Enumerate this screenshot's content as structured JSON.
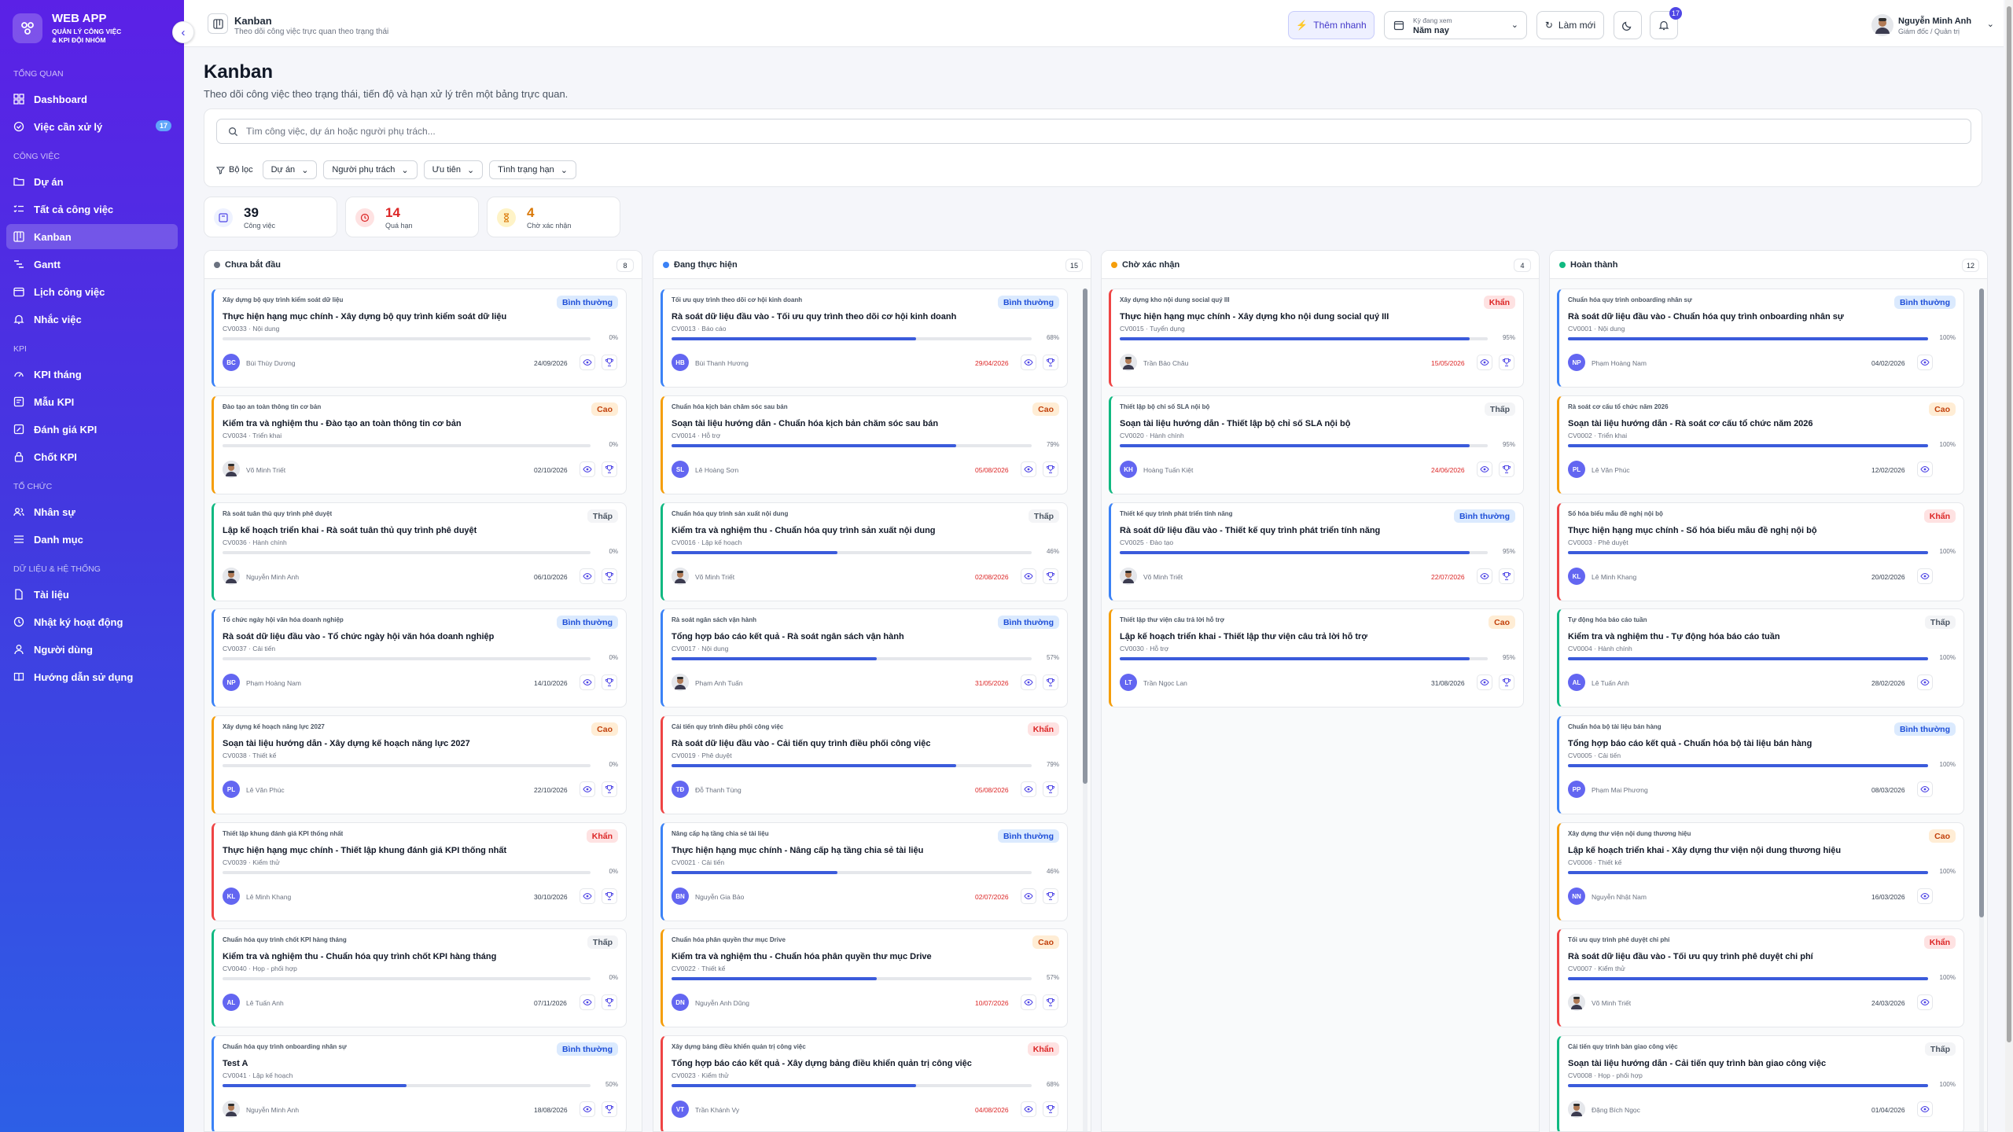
{
  "brand": {
    "name": "WEB APP",
    "sub1": "QUẢN LÝ CÔNG VIỆC",
    "sub2": "& KPI ĐỘI NHÓM"
  },
  "sidebar": {
    "sections": [
      {
        "title": "TỔNG QUAN",
        "items": [
          {
            "label": "Dashboard",
            "icon": "dashboard-icon"
          },
          {
            "label": "Việc cần xử lý",
            "icon": "check-circle-icon",
            "badge": "17"
          }
        ]
      },
      {
        "title": "CÔNG VIỆC",
        "items": [
          {
            "label": "Dự án",
            "icon": "folder-icon"
          },
          {
            "label": "Tất cả công việc",
            "icon": "list-check-icon"
          },
          {
            "label": "Kanban",
            "icon": "kanban-icon",
            "active": true
          },
          {
            "label": "Gantt",
            "icon": "gantt-icon"
          },
          {
            "label": "Lịch công việc",
            "icon": "calendar-icon"
          },
          {
            "label": "Nhắc việc",
            "icon": "bell-icon"
          }
        ]
      },
      {
        "title": "KPI",
        "items": [
          {
            "label": "KPI tháng",
            "icon": "gauge-icon"
          },
          {
            "label": "Mẫu KPI",
            "icon": "template-icon"
          },
          {
            "label": "Đánh giá KPI",
            "icon": "edit-icon"
          },
          {
            "label": "Chốt KPI",
            "icon": "lock-icon"
          }
        ]
      },
      {
        "title": "TỔ CHỨC",
        "items": [
          {
            "label": "Nhân sự",
            "icon": "users-icon"
          },
          {
            "label": "Danh mục",
            "icon": "category-icon"
          }
        ]
      },
      {
        "title": "DỮ LIỆU & HỆ THỐNG",
        "items": [
          {
            "label": "Tài liệu",
            "icon": "document-icon"
          },
          {
            "label": "Nhật ký hoạt động",
            "icon": "history-icon"
          },
          {
            "label": "Người dùng",
            "icon": "user-icon"
          },
          {
            "label": "Hướng dẫn sử dụng",
            "icon": "book-icon"
          }
        ]
      }
    ]
  },
  "topbar": {
    "title": "Kanban",
    "subtitle": "Theo dõi công việc trực quan theo trạng thái",
    "quick_add": "Thêm nhanh",
    "period_label": "Kỳ đang xem",
    "period_value": "Năm nay",
    "refresh": "Làm mới",
    "notif_count": "17",
    "user_name": "Nguyễn Minh Anh",
    "user_role": "Giám đốc / Quản trị"
  },
  "page": {
    "title": "Kanban",
    "subtitle": "Theo dõi công việc theo trạng thái, tiến độ và hạn xử lý trên một bảng trực quan."
  },
  "search": {
    "placeholder": "Tìm công việc, dự án hoặc người phụ trách..."
  },
  "filters": {
    "label": "Bộ lọc",
    "chips": [
      "Dự án",
      "Người phụ trách",
      "Ưu tiên",
      "Tình trạng hạn"
    ]
  },
  "stats": [
    {
      "value": "39",
      "label": "Công việc",
      "color": "#111827",
      "icon": "board-icon"
    },
    {
      "value": "14",
      "label": "Quá hạn",
      "color": "#dc2626",
      "icon": "clock-icon"
    },
    {
      "value": "4",
      "label": "Chờ xác nhận",
      "color": "#d97706",
      "icon": "hourglass-icon"
    }
  ],
  "colors": {
    "accent": "#4f46e5",
    "priority": {
      "Bình thường": {
        "bg": "#dbeafe",
        "fg": "#1d4ed8",
        "border": "#3b82f6"
      },
      "Cao": {
        "bg": "#ffedd5",
        "fg": "#c2410c",
        "border": "#f59e0b"
      },
      "Khẩn": {
        "bg": "#fee2e2",
        "fg": "#dc2626",
        "border": "#ef4444"
      },
      "Thấp": {
        "bg": "#f3f4f6",
        "fg": "#4b5563",
        "border": "#10b981"
      }
    }
  },
  "columns": [
    {
      "title": "Chưa bắt đầu",
      "count": "8",
      "dot": "#6b7280",
      "thumb_top": 0,
      "thumb_h": 0,
      "cards": [
        {
          "parent": "Xây dựng bộ quy trình kiểm soát dữ liệu",
          "priority": "Bình thường",
          "title": "Thực hiện hạng mục chính - Xây dựng bộ quy trình kiểm soát dữ liệu",
          "code": "CV0033 · Nội dung",
          "progress": 0,
          "initials": "BC",
          "avatar": "#6366f1",
          "person": "Bùi Thùy Dương",
          "date": "24/09/2026",
          "overdue": false
        },
        {
          "parent": "Đào tạo an toàn thông tin cơ bản",
          "priority": "Cao",
          "title": "Kiểm tra và nghiệm thu - Đào tạo an toàn thông tin cơ bản",
          "code": "CV0034 · Triển khai",
          "progress": 0,
          "initials": "",
          "avatar": "photo",
          "person": "Võ Minh Triết",
          "date": "02/10/2026",
          "overdue": false
        },
        {
          "parent": "Rà soát tuân thủ quy trình phê duyệt",
          "priority": "Thấp",
          "title": "Lập kế hoạch triển khai - Rà soát tuân thủ quy trình phê duyệt",
          "code": "CV0036 · Hành chính",
          "progress": 0,
          "initials": "",
          "avatar": "photo",
          "person": "Nguyễn Minh Anh",
          "date": "06/10/2026",
          "overdue": false
        },
        {
          "parent": "Tổ chức ngày hội văn hóa doanh nghiệp",
          "priority": "Bình thường",
          "title": "Rà soát dữ liệu đầu vào - Tổ chức ngày hội văn hóa doanh nghiệp",
          "code": "CV0037 · Cải tiến",
          "progress": 0,
          "initials": "NP",
          "avatar": "#6366f1",
          "person": "Phạm Hoàng Nam",
          "date": "14/10/2026",
          "overdue": false
        },
        {
          "parent": "Xây dựng kế hoạch năng lực 2027",
          "priority": "Cao",
          "title": "Soạn tài liệu hướng dẫn - Xây dựng kế hoạch năng lực 2027",
          "code": "CV0038 · Thiết kế",
          "progress": 0,
          "initials": "PL",
          "avatar": "#6366f1",
          "person": "Lê Văn Phúc",
          "date": "22/10/2026",
          "overdue": false
        },
        {
          "parent": "Thiết lập khung đánh giá KPI thống nhất",
          "priority": "Khẩn",
          "title": "Thực hiện hạng mục chính - Thiết lập khung đánh giá KPI thống nhất",
          "code": "CV0039 · Kiểm thử",
          "progress": 0,
          "initials": "KL",
          "avatar": "#6366f1",
          "person": "Lê Minh Khang",
          "date": "30/10/2026",
          "overdue": false
        },
        {
          "parent": "Chuẩn hóa quy trình chốt KPI hàng tháng",
          "priority": "Thấp",
          "title": "Kiểm tra và nghiệm thu - Chuẩn hóa quy trình chốt KPI hàng tháng",
          "code": "CV0040 · Họp - phối hợp",
          "progress": 0,
          "initials": "AL",
          "avatar": "#6366f1",
          "person": "Lê Tuấn Anh",
          "date": "07/11/2026",
          "overdue": false
        },
        {
          "parent": "Chuẩn hóa quy trình onboarding nhân sự",
          "priority": "Bình thường",
          "title": "Test A",
          "code": "CV0041 · Lập kế hoạch",
          "progress": 50,
          "initials": "",
          "avatar": "photo",
          "person": "Nguyễn Minh Anh",
          "date": "18/08/2026",
          "overdue": false
        }
      ]
    },
    {
      "title": "Đang thực hiện",
      "count": "15",
      "dot": "#3b82f6",
      "thumb_top": 0,
      "thumb_h": 630,
      "cards": [
        {
          "parent": "Tối ưu quy trình theo dõi cơ hội kinh doanh",
          "priority": "Bình thường",
          "title": "Rà soát dữ liệu đầu vào - Tối ưu quy trình theo dõi cơ hội kinh doanh",
          "code": "CV0013 · Báo cáo",
          "progress": 68,
          "initials": "HB",
          "avatar": "#6366f1",
          "person": "Bùi Thanh Hương",
          "date": "29/04/2026",
          "overdue": true
        },
        {
          "parent": "Chuẩn hóa kịch bản chăm sóc sau bán",
          "priority": "Cao",
          "title": "Soạn tài liệu hướng dẫn - Chuẩn hóa kịch bản chăm sóc sau bán",
          "code": "CV0014 · Hỗ trợ",
          "progress": 79,
          "initials": "SL",
          "avatar": "#6366f1",
          "person": "Lê Hoàng Sơn",
          "date": "05/08/2026",
          "overdue": true
        },
        {
          "parent": "Chuẩn hóa quy trình sản xuất nội dung",
          "priority": "Thấp",
          "title": "Kiểm tra và nghiệm thu - Chuẩn hóa quy trình sản xuất nội dung",
          "code": "CV0016 · Lập kế hoạch",
          "progress": 46,
          "initials": "",
          "avatar": "photo",
          "person": "Võ Minh Triết",
          "date": "02/08/2026",
          "overdue": true
        },
        {
          "parent": "Rà soát ngân sách vận hành",
          "priority": "Bình thường",
          "title": "Tổng hợp báo cáo kết quả - Rà soát ngân sách vận hành",
          "code": "CV0017 · Nội dung",
          "progress": 57,
          "initials": "",
          "avatar": "photo",
          "person": "Phạm Anh Tuấn",
          "date": "31/05/2026",
          "overdue": true
        },
        {
          "parent": "Cải tiến quy trình điều phối công việc",
          "priority": "Khẩn",
          "title": "Rà soát dữ liệu đầu vào - Cải tiến quy trình điều phối công việc",
          "code": "CV0019 · Phê duyệt",
          "progress": 79,
          "initials": "TĐ",
          "avatar": "#6366f1",
          "person": "Đỗ Thanh Tùng",
          "date": "05/08/2026",
          "overdue": true
        },
        {
          "parent": "Nâng cấp hạ tầng chia sẻ tài liệu",
          "priority": "Bình thường",
          "title": "Thực hiện hạng mục chính - Nâng cấp hạ tầng chia sẻ tài liệu",
          "code": "CV0021 · Cải tiến",
          "progress": 46,
          "initials": "BN",
          "avatar": "#6366f1",
          "person": "Nguyễn Gia Bảo",
          "date": "02/07/2026",
          "overdue": true
        },
        {
          "parent": "Chuẩn hóa phân quyền thư mục Drive",
          "priority": "Cao",
          "title": "Kiểm tra và nghiệm thu - Chuẩn hóa phân quyền thư mục Drive",
          "code": "CV0022 · Thiết kế",
          "progress": 57,
          "initials": "DN",
          "avatar": "#6366f1",
          "person": "Nguyễn Anh Dũng",
          "date": "10/07/2026",
          "overdue": true
        },
        {
          "parent": "Xây dựng bảng điều khiển quản trị công việc",
          "priority": "Khẩn",
          "title": "Tổng hợp báo cáo kết quả - Xây dựng bảng điều khiển quản trị công việc",
          "code": "CV0023 · Kiểm thử",
          "progress": 68,
          "initials": "VT",
          "avatar": "#6366f1",
          "person": "Trần Khánh Vy",
          "date": "04/08/2026",
          "overdue": true
        }
      ]
    },
    {
      "title": "Chờ xác nhận",
      "count": "4",
      "dot": "#f59e0b",
      "thumb_top": 0,
      "thumb_h": 0,
      "cards": [
        {
          "parent": "Xây dựng kho nội dung social quý III",
          "priority": "Khẩn",
          "title": "Thực hiện hạng mục chính - Xây dựng kho nội dung social quý III",
          "code": "CV0015 · Tuyển dụng",
          "progress": 95,
          "initials": "",
          "avatar": "photo",
          "person": "Trần Bảo Châu",
          "date": "15/05/2026",
          "overdue": true
        },
        {
          "parent": "Thiết lập bộ chỉ số SLA nội bộ",
          "priority": "Thấp",
          "title": "Soạn tài liệu hướng dẫn - Thiết lập bộ chỉ số SLA nội bộ",
          "code": "CV0020 · Hành chính",
          "progress": 95,
          "initials": "KH",
          "avatar": "#6366f1",
          "person": "Hoàng Tuấn Kiệt",
          "date": "24/06/2026",
          "overdue": true
        },
        {
          "parent": "Thiết kế quy trình phát triển tính năng",
          "priority": "Bình thường",
          "title": "Rà soát dữ liệu đầu vào - Thiết kế quy trình phát triển tính năng",
          "code": "CV0025 · Đào tạo",
          "progress": 95,
          "initials": "",
          "avatar": "photo",
          "person": "Võ Minh Triết",
          "date": "22/07/2026",
          "overdue": true
        },
        {
          "parent": "Thiết lập thư viện câu trả lời hỗ trợ",
          "priority": "Cao",
          "title": "Lập kế hoạch triển khai - Thiết lập thư viện câu trả lời hỗ trợ",
          "code": "CV0030 · Hỗ trợ",
          "progress": 95,
          "initials": "LT",
          "avatar": "#6366f1",
          "person": "Trần Ngọc Lan",
          "date": "31/08/2026",
          "overdue": false
        }
      ]
    },
    {
      "title": "Hoàn thành",
      "count": "12",
      "dot": "#10b981",
      "thumb_top": 0,
      "thumb_h": 800,
      "cards": [
        {
          "parent": "Chuẩn hóa quy trình onboarding nhân sự",
          "priority": "Bình thường",
          "title": "Rà soát dữ liệu đầu vào - Chuẩn hóa quy trình onboarding nhân sự",
          "code": "CV0001 · Nội dung",
          "progress": 100,
          "initials": "NP",
          "avatar": "#6366f1",
          "person": "Phạm Hoàng Nam",
          "date": "04/02/2026",
          "overdue": false
        },
        {
          "parent": "Rà soát cơ cấu tổ chức năm 2026",
          "priority": "Cao",
          "title": "Soạn tài liệu hướng dẫn - Rà soát cơ cấu tổ chức năm 2026",
          "code": "CV0002 · Triển khai",
          "progress": 100,
          "initials": "PL",
          "avatar": "#6366f1",
          "person": "Lê Văn Phúc",
          "date": "12/02/2026",
          "overdue": false
        },
        {
          "parent": "Số hóa biểu mẫu đề nghị nội bộ",
          "priority": "Khẩn",
          "title": "Thực hiện hạng mục chính - Số hóa biểu mẫu đề nghị nội bộ",
          "code": "CV0003 · Phê duyệt",
          "progress": 100,
          "initials": "KL",
          "avatar": "#6366f1",
          "person": "Lê Minh Khang",
          "date": "20/02/2026",
          "overdue": false
        },
        {
          "parent": "Tự động hóa báo cáo tuần",
          "priority": "Thấp",
          "title": "Kiểm tra và nghiệm thu - Tự động hóa báo cáo tuần",
          "code": "CV0004 · Hành chính",
          "progress": 100,
          "initials": "AL",
          "avatar": "#6366f1",
          "person": "Lê Tuấn Anh",
          "date": "28/02/2026",
          "overdue": false
        },
        {
          "parent": "Chuẩn hóa bộ tài liệu bán hàng",
          "priority": "Bình thường",
          "title": "Tổng hợp báo cáo kết quả - Chuẩn hóa bộ tài liệu bán hàng",
          "code": "CV0005 · Cải tiến",
          "progress": 100,
          "initials": "PP",
          "avatar": "#6366f1",
          "person": "Phạm Mai Phương",
          "date": "08/03/2026",
          "overdue": false
        },
        {
          "parent": "Xây dựng thư viện nội dung thương hiệu",
          "priority": "Cao",
          "title": "Lập kế hoạch triển khai - Xây dựng thư viện nội dung thương hiệu",
          "code": "CV0006 · Thiết kế",
          "progress": 100,
          "initials": "NN",
          "avatar": "#6366f1",
          "person": "Nguyễn Nhật Nam",
          "date": "16/03/2026",
          "overdue": false
        },
        {
          "parent": "Tối ưu quy trình phê duyệt chi phí",
          "priority": "Khẩn",
          "title": "Rà soát dữ liệu đầu vào - Tối ưu quy trình phê duyệt chi phí",
          "code": "CV0007 · Kiểm thử",
          "progress": 100,
          "initials": "",
          "avatar": "photo",
          "person": "Võ Minh Triết",
          "date": "24/03/2026",
          "overdue": false
        },
        {
          "parent": "Cải tiến quy trình bàn giao công việc",
          "priority": "Thấp",
          "title": "Soạn tài liệu hướng dẫn - Cải tiến quy trình bàn giao công việc",
          "code": "CV0008 · Họp - phối hợp",
          "progress": 100,
          "initials": "",
          "avatar": "photo",
          "person": "Đặng Bích Ngọc",
          "date": "01/04/2026",
          "overdue": false
        }
      ]
    }
  ]
}
